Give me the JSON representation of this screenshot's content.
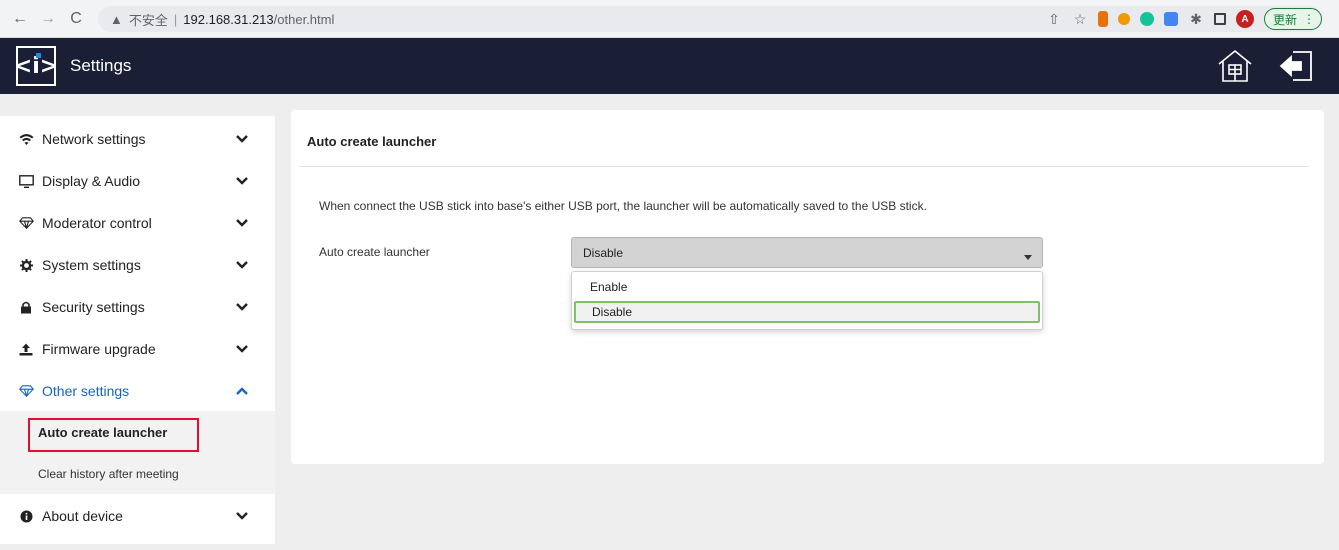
{
  "browser": {
    "insecure_label": "不安全",
    "url_host": "192.168.31.213",
    "url_path": "/other.html",
    "update_label": "更新",
    "avatar_letter": "A"
  },
  "header": {
    "logo_text": "<i>",
    "title": "Settings"
  },
  "sidebar": {
    "items": [
      {
        "label": "Network settings",
        "icon": "wifi-icon",
        "chevron": "chevron-down"
      },
      {
        "label": "Display & Audio",
        "icon": "monitor-icon",
        "chevron": "chevron-down"
      },
      {
        "label": "Moderator control",
        "icon": "diamond-icon",
        "chevron": "chevron-down"
      },
      {
        "label": "System settings",
        "icon": "gear-icon",
        "chevron": "chevron-down"
      },
      {
        "label": "Security settings",
        "icon": "lock-icon",
        "chevron": "chevron-down"
      },
      {
        "label": "Firmware upgrade",
        "icon": "upload-icon",
        "chevron": "chevron-down"
      },
      {
        "label": "Other settings",
        "icon": "diamond-icon",
        "chevron": "chevron-up"
      },
      {
        "label": "About device",
        "icon": "info-icon",
        "chevron": "chevron-down"
      }
    ],
    "sub_items": [
      {
        "label": "Auto create launcher",
        "selected": true
      },
      {
        "label": "Clear history after meeting",
        "selected": false
      }
    ]
  },
  "main": {
    "card_title": "Auto create launcher",
    "description": "When connect the USB stick into base's either USB port, the launcher will be automatically saved to the USB stick.",
    "field_label": "Auto create launcher",
    "select_value": "Disable",
    "options": [
      "Enable",
      "Disable"
    ]
  },
  "colors": {
    "header_bg": "#1a1f36",
    "active_blue": "#1565c0",
    "highlight_red": "#e0102a",
    "option_green": "#7dc36a"
  }
}
